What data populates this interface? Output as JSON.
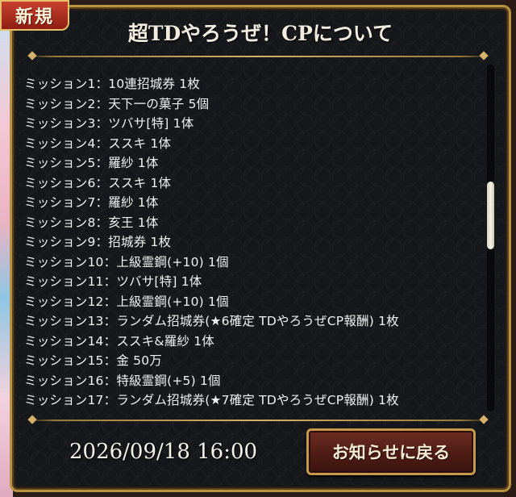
{
  "badge": {
    "label": "新規"
  },
  "dialog": {
    "title": "超TDやろうぜ！CPについて"
  },
  "missions": [
    "ミッション1：10連招城券 1枚",
    "ミッション2：天下一の菓子 5個",
    "ミッション3：ツバサ[特] 1体",
    "ミッション4：ススキ 1体",
    "ミッション5：羅紗 1体",
    "ミッション6：ススキ 1体",
    "ミッション7：羅紗 1体",
    "ミッション8：亥王 1体",
    "ミッション9：招城券 1枚",
    "ミッション10：上級霊鋼(+10) 1個",
    "ミッション11：ツバサ[特] 1体",
    "ミッション12：上級霊鋼(+10) 1個",
    "ミッション13：ランダム招城券(★6確定 TDやろうぜCP報酬) 1枚",
    "ミッション14：ススキ&羅紗 1体",
    "ミッション15：金 50万",
    "ミッション16：特級霊鋼(+5) 1個",
    "ミッション17：ランダム招城券(★7確定 TDやろうぜCP報酬) 1枚"
  ],
  "scroll": {
    "position": 0.42
  },
  "footer": {
    "datetime": "2026/09/18 16:00",
    "back_button_label": "お知らせに戻る"
  },
  "colors": {
    "frame_gold": "#b8923e",
    "background": "#16171a",
    "badge_red": "#c8412e",
    "button_maroon": "#4d1c14"
  }
}
